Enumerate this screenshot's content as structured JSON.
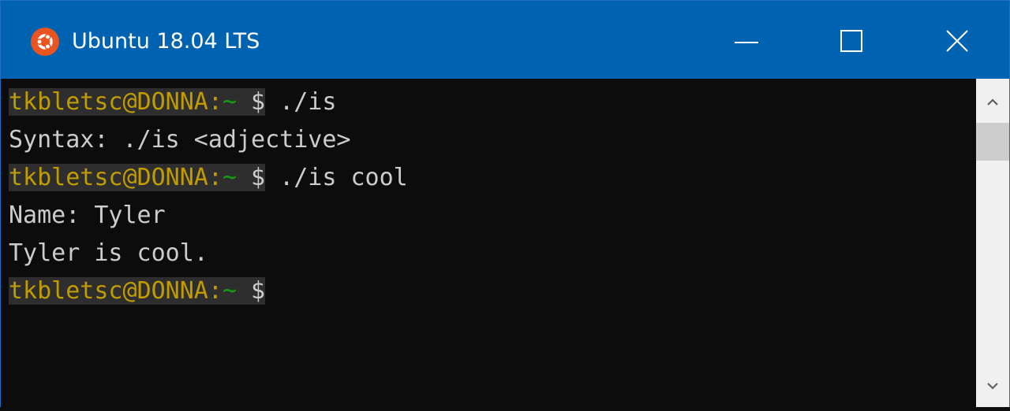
{
  "window": {
    "title": "Ubuntu 18.04 LTS",
    "app_icon": "ubuntu-logo-icon",
    "controls": [
      "minimize-icon",
      "maximize-icon",
      "close-icon"
    ],
    "accent": "#0063b1",
    "icon_color": "#e95420"
  },
  "terminal": {
    "background": "#0c0c0c",
    "prompt": {
      "user": "tkbletsc",
      "at": "@",
      "host": "DONNA",
      "colon": ":",
      "path": "~",
      "symbol": "$",
      "user_color": "#c19c00",
      "path_color": "#13a10e"
    },
    "lines": [
      {
        "type": "prompt",
        "command": "./is"
      },
      {
        "type": "output",
        "text": "Syntax: ./is <adjective>"
      },
      {
        "type": "prompt",
        "command": "./is cool"
      },
      {
        "type": "output",
        "text": "Name: Tyler"
      },
      {
        "type": "output",
        "text": "Tyler is cool."
      },
      {
        "type": "prompt",
        "command": ""
      }
    ]
  },
  "scrollbar": {
    "up_icon": "chevron-up-icon",
    "down_icon": "chevron-down-icon"
  }
}
